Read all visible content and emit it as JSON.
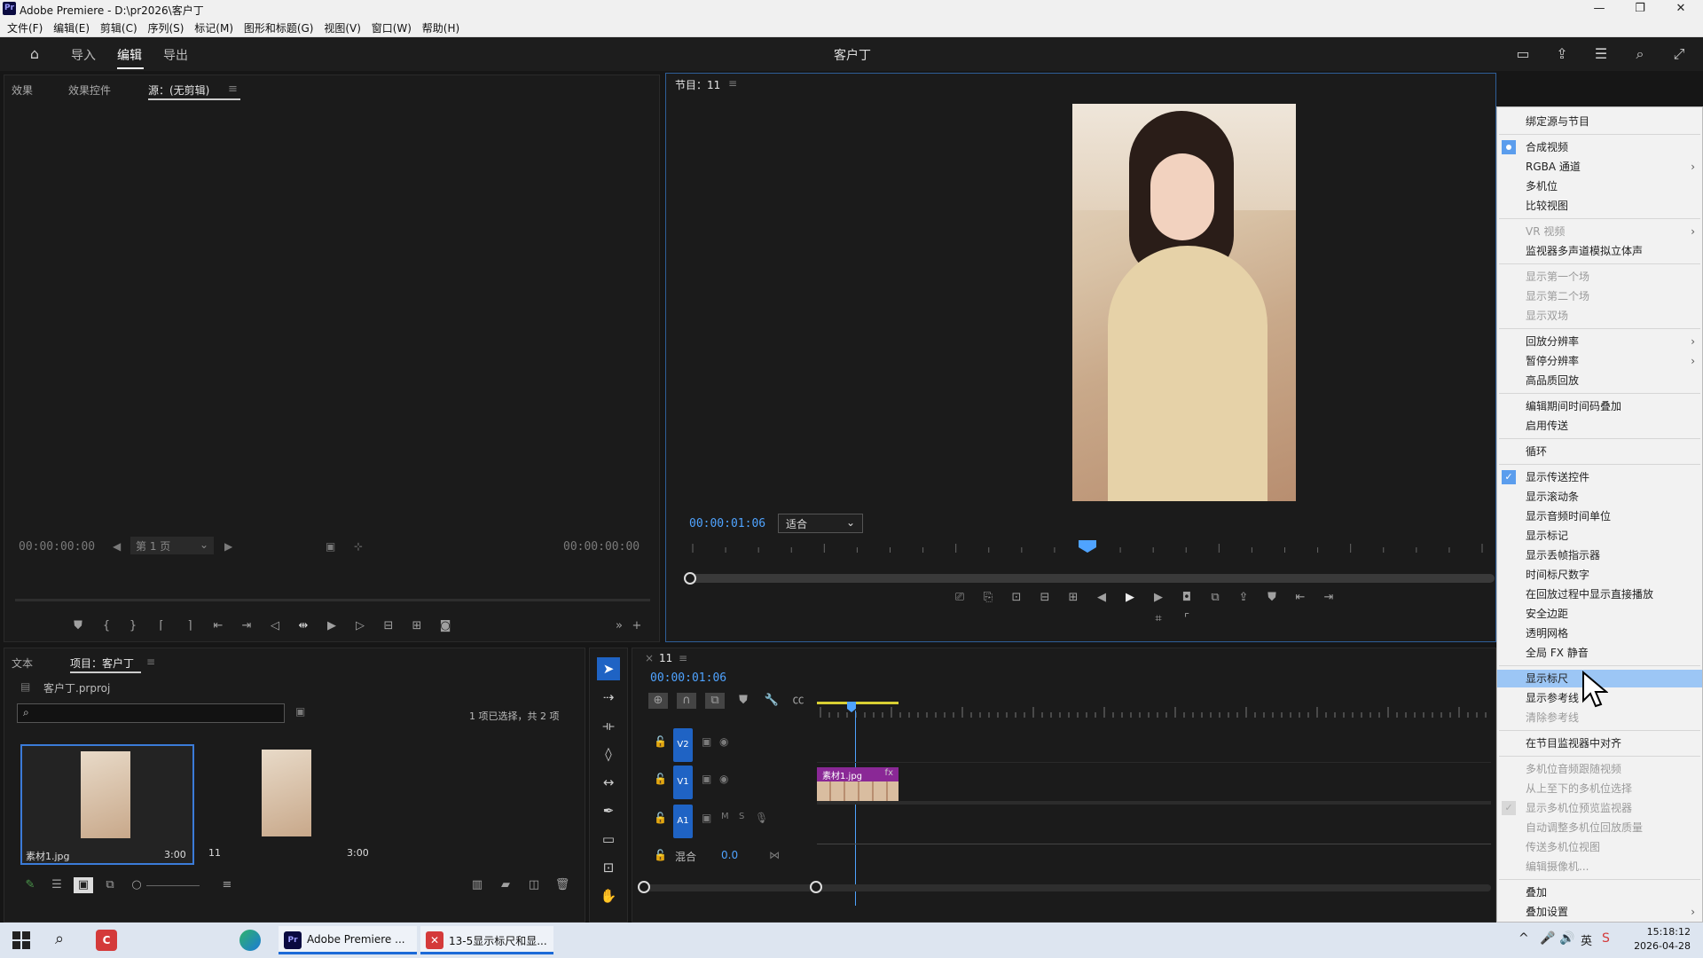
{
  "window": {
    "title": "Adobe Premiere - D:\\pr2026\\客户丁",
    "logo": "Pr",
    "controls": {
      "minimize": "—",
      "restore": "❐",
      "close": "✕"
    }
  },
  "menubar": [
    "文件(F)",
    "编辑(E)",
    "剪辑(C)",
    "序列(S)",
    "标记(M)",
    "图形和标题(G)",
    "视图(V)",
    "窗口(W)",
    "帮助(H)"
  ],
  "workspace": {
    "tabs": [
      "导入",
      "编辑",
      "导出"
    ],
    "active": "编辑",
    "project_title": "客户丁"
  },
  "source_panel": {
    "tabs": [
      "效果",
      "效果控件",
      "源：(无剪辑)"
    ],
    "tc_left": "00:00:00:00",
    "page_label": "第 1 页",
    "tc_right": "00:00:00:00"
  },
  "program_monitor": {
    "title": "节目：11",
    "timecode": "00:00:01:06",
    "fit_label": "适合",
    "playhead_progress": 0.5
  },
  "project_panel": {
    "tabs": [
      "文本",
      "项目：客户丁"
    ],
    "file": "客户丁.prproj",
    "selection_info": "1 项已选择，共 2 项",
    "items": [
      {
        "name": "素材1.jpg",
        "duration": "3:00"
      },
      {
        "name": "11",
        "duration": "3:00"
      }
    ]
  },
  "timeline": {
    "sequence": "11",
    "timecode": "00:00:01:06",
    "tracks": [
      "V2",
      "V1",
      "A1"
    ],
    "mix_label": "混合",
    "mix_value": "0.0",
    "audio_m": "M",
    "audio_s": "S",
    "clip_name": "素材1.jpg",
    "clip_fx": "fx"
  },
  "context_menu": {
    "items": [
      {
        "label": "绑定源与节目",
        "state": "normal"
      },
      {
        "label": "合成视频",
        "state": "radio"
      },
      {
        "label": "RGBA 通道",
        "state": "submenu"
      },
      {
        "label": "多机位",
        "state": "normal"
      },
      {
        "label": "比较视图",
        "state": "normal"
      },
      {
        "label": "VR 视频",
        "state": "disabled-submenu"
      },
      {
        "label": "监视器多声道模拟立体声",
        "state": "normal"
      },
      {
        "label": "显示第一个场",
        "state": "disabled"
      },
      {
        "label": "显示第二个场",
        "state": "disabled"
      },
      {
        "label": "显示双场",
        "state": "disabled"
      },
      {
        "label": "回放分辨率",
        "state": "submenu"
      },
      {
        "label": "暂停分辨率",
        "state": "submenu"
      },
      {
        "label": "高品质回放",
        "state": "normal"
      },
      {
        "label": "编辑期间时间码叠加",
        "state": "normal"
      },
      {
        "label": "启用传送",
        "state": "normal"
      },
      {
        "label": "循环",
        "state": "normal"
      },
      {
        "label": "显示传送控件",
        "state": "checked"
      },
      {
        "label": "显示滚动条",
        "state": "normal"
      },
      {
        "label": "显示音频时间单位",
        "state": "normal"
      },
      {
        "label": "显示标记",
        "state": "normal"
      },
      {
        "label": "显示丢帧指示器",
        "state": "normal"
      },
      {
        "label": "时间标尺数字",
        "state": "normal"
      },
      {
        "label": "在回放过程中显示直接播放",
        "state": "normal"
      },
      {
        "label": "安全边距",
        "state": "normal"
      },
      {
        "label": "透明网格",
        "state": "normal"
      },
      {
        "label": "全局 FX 静音",
        "state": "normal"
      },
      {
        "label": "显示标尺",
        "state": "highlighted"
      },
      {
        "label": "显示参考线",
        "state": "normal"
      },
      {
        "label": "清除参考线",
        "state": "disabled"
      },
      {
        "label": "在节目监视器中对齐",
        "state": "normal"
      },
      {
        "label": "多机位音频跟随视频",
        "state": "disabled"
      },
      {
        "label": "从上至下的多机位选择",
        "state": "disabled"
      },
      {
        "label": "显示多机位预览监视器",
        "state": "disabled-checked"
      },
      {
        "label": "自动调整多机位回放质量",
        "state": "disabled"
      },
      {
        "label": "传送多机位视图",
        "state": "disabled"
      },
      {
        "label": "编辑摄像机...",
        "state": "disabled"
      },
      {
        "label": "叠加",
        "state": "normal"
      },
      {
        "label": "叠加设置",
        "state": "submenu"
      }
    ]
  },
  "taskbar": {
    "apps": [
      "Adobe Premiere ...",
      "13-5显示标尺和显..."
    ],
    "time": "15:18:12",
    "date": "2026-04-28",
    "ime": "英"
  },
  "colors": {
    "accent": "#4fa3ff",
    "track": "#1f63c4",
    "clip": "#9b2fa6",
    "menu_highlight": "#9cc6f5"
  }
}
